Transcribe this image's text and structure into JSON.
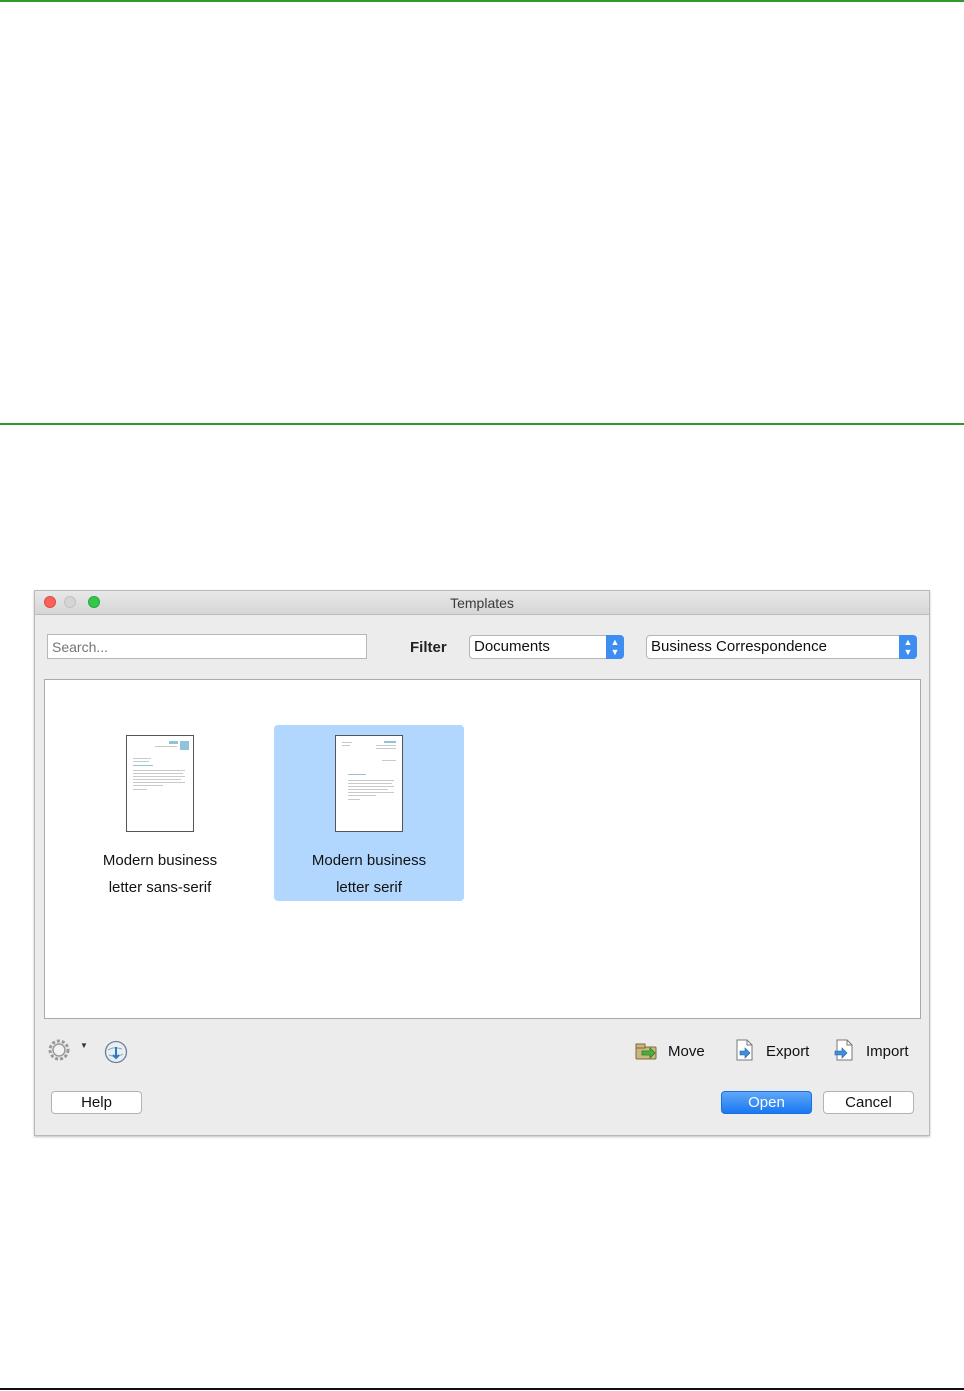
{
  "window": {
    "title": "Templates"
  },
  "search": {
    "placeholder": "Search..."
  },
  "filter": {
    "label": "Filter",
    "type_value": "Documents",
    "category_value": "Business Correspondence"
  },
  "templates": [
    {
      "line1": "Modern business",
      "line2": "letter sans-serif",
      "selected": false
    },
    {
      "line1": "Modern business",
      "line2": "letter serif",
      "selected": true
    }
  ],
  "actions": {
    "move": "Move",
    "export": "Export",
    "import": "Import"
  },
  "buttons": {
    "help": "Help",
    "open": "Open",
    "cancel": "Cancel"
  },
  "colors": {
    "accent": "#1978f2",
    "selection": "#b2d7ff",
    "rule": "#2e9a2e"
  },
  "icons": [
    "gear-icon",
    "web-repository-icon",
    "move-icon",
    "export-icon",
    "import-icon"
  ]
}
